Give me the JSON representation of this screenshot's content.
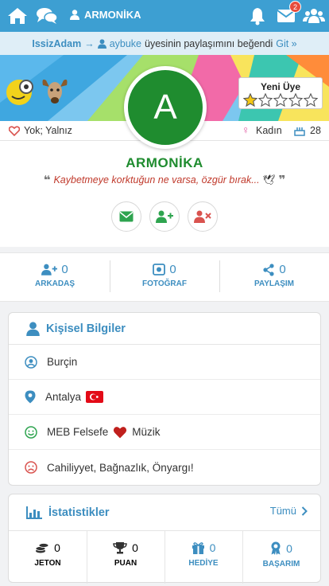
{
  "topbar": {
    "title": "ARMONİKA",
    "message_badge": "2",
    "icons": [
      "home-icon",
      "chat-icon",
      "user-icon",
      "bell-icon",
      "envelope-icon",
      "users-icon"
    ]
  },
  "notice": {
    "user": "IssizAdam",
    "arrow": "→",
    "target": "aybuke",
    "text": "üyesinin paylaşımını beğendi",
    "link": "Git »"
  },
  "banner": {
    "new_member_label": "Yeni Üye",
    "stars_filled": 1,
    "stars_total": 5
  },
  "avatar": {
    "letter": "A",
    "color": "#1f8c2f"
  },
  "info": {
    "relationship": "Yok; Yalnız",
    "gender": "Kadın",
    "age": "28"
  },
  "profile": {
    "name": "ARMONİKA",
    "quote": "Kaybetmeye korktuğun ne varsa, özgür bırak..."
  },
  "counters": [
    {
      "value": "0",
      "label": "ARKADAŞ",
      "icon": "user-plus-icon"
    },
    {
      "value": "0",
      "label": "FOTOĞRAF",
      "icon": "photo-icon"
    },
    {
      "value": "0",
      "label": "PAYLAŞIM",
      "icon": "share-icon"
    }
  ],
  "personal": {
    "title": "Kişisel Bilgiler",
    "rows": [
      {
        "icon": "user-circle-icon",
        "text": "Burçin"
      },
      {
        "icon": "map-marker-icon",
        "text": "Antalya"
      },
      {
        "icon": "smile-icon",
        "text_before": "MEB Felsefe",
        "text_after": "Müzik"
      },
      {
        "icon": "frown-icon",
        "text": "Cahiliyyet, Bağnazlık, Önyargı!"
      }
    ]
  },
  "statistics": {
    "title": "İstatistikler",
    "more": "Tümü",
    "items": [
      {
        "value": "0",
        "label": "JETON",
        "color": "#222222",
        "icon": "coins-icon"
      },
      {
        "value": "0",
        "label": "PUAN",
        "color": "#222222",
        "icon": "trophy-icon"
      },
      {
        "value": "0",
        "label": "HEDİYE",
        "color": "#3d8ec0",
        "icon": "gift-icon"
      },
      {
        "value": "0",
        "label": "BAŞARIM",
        "color": "#3d8ec0",
        "icon": "award-icon"
      }
    ]
  },
  "colors": {
    "accent": "#3d9fd2",
    "green": "#1f8c2f",
    "red": "#c0392b"
  }
}
